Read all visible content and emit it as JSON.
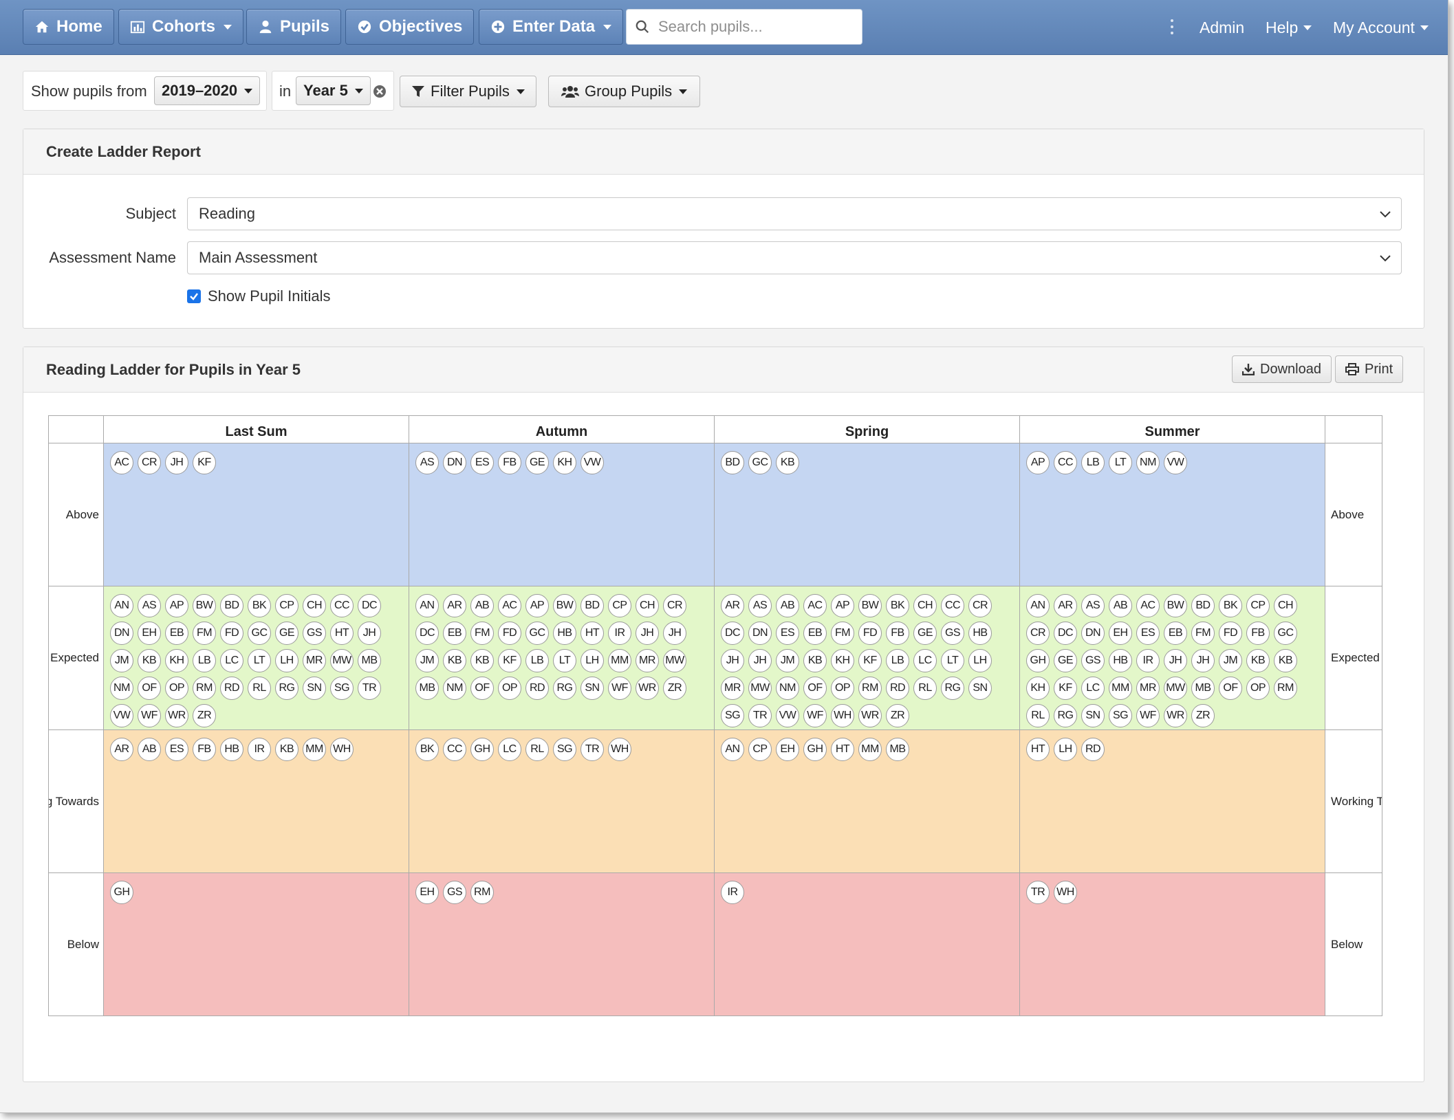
{
  "nav": {
    "home": "Home",
    "cohorts": "Cohorts",
    "pupils": "Pupils",
    "objectives": "Objectives",
    "enter_data": "Enter Data",
    "search_placeholder": "Search pupils...",
    "admin": "Admin",
    "help": "Help",
    "account": "My Account"
  },
  "filters": {
    "show_from_label": "Show pupils from",
    "year_range": "2019–2020",
    "in_label": "in",
    "year_group": "Year 5",
    "filter_pupils": "Filter Pupils",
    "group_pupils": "Group Pupils"
  },
  "create_panel": {
    "title": "Create Ladder Report",
    "subject_label": "Subject",
    "subject_value": "Reading",
    "assessment_label": "Assessment Name",
    "assessment_value": "Main Assessment",
    "show_initials_label": "Show Pupil Initials",
    "show_initials_checked": true
  },
  "ladder_panel": {
    "title": "Reading Ladder for Pupils in Year 5",
    "download": "Download",
    "print": "Print"
  },
  "ladder": {
    "columns": [
      "Last Sum",
      "Autumn",
      "Spring",
      "Summer"
    ],
    "rows": [
      {
        "label_left": "Above",
        "label_right": "Above",
        "color": "#c5d6f2",
        "cells": [
          [
            "AC",
            "CR",
            "JH",
            "KF"
          ],
          [
            "AS",
            "DN",
            "ES",
            "FB",
            "GE",
            "KH",
            "VW"
          ],
          [
            "BD",
            "GC",
            "KB"
          ],
          [
            "AP",
            "CC",
            "LB",
            "LT",
            "NM",
            "VW"
          ]
        ]
      },
      {
        "label_left": "Expected",
        "label_right": "Expected",
        "color": "#e3f7c9",
        "cells": [
          [
            "AN",
            "AS",
            "AP",
            "BW",
            "BD",
            "BK",
            "CP",
            "CH",
            "CC",
            "DC",
            "DN",
            "EH",
            "EB",
            "FM",
            "FD",
            "GC",
            "GE",
            "GS",
            "HT",
            "JH",
            "JM",
            "KB",
            "KH",
            "LB",
            "LC",
            "LT",
            "LH",
            "MR",
            "MW",
            "MB",
            "NM",
            "OF",
            "OP",
            "RM",
            "RD",
            "RL",
            "RG",
            "SN",
            "SG",
            "TR",
            "VW",
            "WF",
            "WR",
            "ZR"
          ],
          [
            "AN",
            "AR",
            "AB",
            "AC",
            "AP",
            "BW",
            "BD",
            "CP",
            "CH",
            "CR",
            "DC",
            "EB",
            "FM",
            "FD",
            "GC",
            "HB",
            "HT",
            "IR",
            "JH",
            "JH",
            "JM",
            "KB",
            "KB",
            "KF",
            "LB",
            "LT",
            "LH",
            "MM",
            "MR",
            "MW",
            "MB",
            "NM",
            "OF",
            "OP",
            "RD",
            "RG",
            "SN",
            "WF",
            "WR",
            "ZR"
          ],
          [
            "AR",
            "AS",
            "AB",
            "AC",
            "AP",
            "BW",
            "BK",
            "CH",
            "CC",
            "CR",
            "DC",
            "DN",
            "ES",
            "EB",
            "FM",
            "FD",
            "FB",
            "GE",
            "GS",
            "HB",
            "JH",
            "JH",
            "JM",
            "KB",
            "KH",
            "KF",
            "LB",
            "LC",
            "LT",
            "LH",
            "MR",
            "MW",
            "NM",
            "OF",
            "OP",
            "RM",
            "RD",
            "RL",
            "RG",
            "SN",
            "SG",
            "TR",
            "VW",
            "WF",
            "WH",
            "WR",
            "ZR"
          ],
          [
            "AN",
            "AR",
            "AS",
            "AB",
            "AC",
            "BW",
            "BD",
            "BK",
            "CP",
            "CH",
            "CR",
            "DC",
            "DN",
            "EH",
            "ES",
            "EB",
            "FM",
            "FD",
            "FB",
            "GC",
            "GH",
            "GE",
            "GS",
            "HB",
            "IR",
            "JH",
            "JH",
            "JM",
            "KB",
            "KB",
            "KH",
            "KF",
            "LC",
            "MM",
            "MR",
            "MW",
            "MB",
            "OF",
            "OP",
            "RM",
            "RL",
            "RG",
            "SN",
            "SG",
            "WF",
            "WR",
            "ZR"
          ]
        ]
      },
      {
        "label_left": "Working Towards",
        "label_right": "Working Towards",
        "color": "#fbdfb5",
        "cells": [
          [
            "AR",
            "AB",
            "ES",
            "FB",
            "HB",
            "IR",
            "KB",
            "MM",
            "WH"
          ],
          [
            "BK",
            "CC",
            "GH",
            "LC",
            "RL",
            "SG",
            "TR",
            "WH"
          ],
          [
            "AN",
            "CP",
            "EH",
            "GH",
            "HT",
            "MM",
            "MB"
          ],
          [
            "HT",
            "LH",
            "RD"
          ]
        ]
      },
      {
        "label_left": "Below",
        "label_right": "Below",
        "color": "#f5bebd",
        "cells": [
          [
            "GH"
          ],
          [
            "EH",
            "GS",
            "RM"
          ],
          [
            "IR"
          ],
          [
            "TR",
            "WH"
          ]
        ]
      }
    ]
  }
}
